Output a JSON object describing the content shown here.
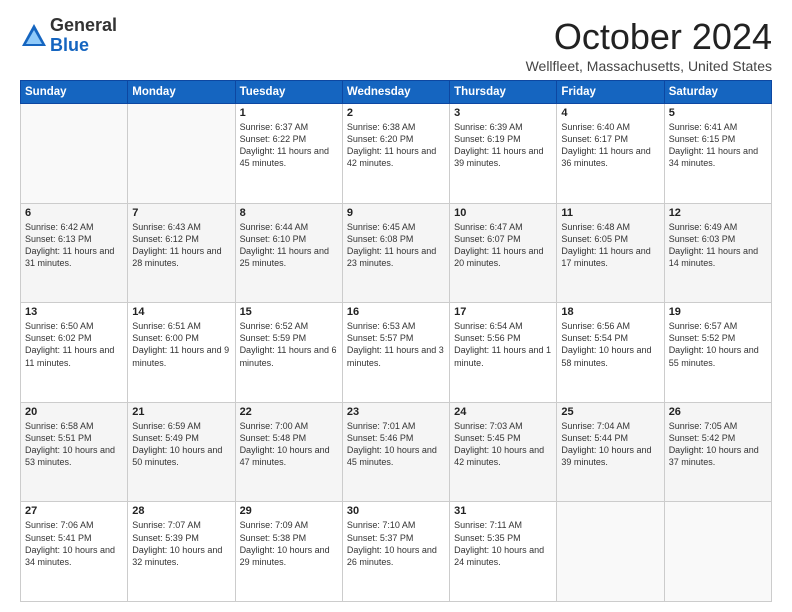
{
  "logo": {
    "general": "General",
    "blue": "Blue"
  },
  "title": "October 2024",
  "location": "Wellfleet, Massachusetts, United States",
  "days_header": [
    "Sunday",
    "Monday",
    "Tuesday",
    "Wednesday",
    "Thursday",
    "Friday",
    "Saturday"
  ],
  "weeks": [
    [
      {
        "day": "",
        "info": ""
      },
      {
        "day": "",
        "info": ""
      },
      {
        "day": "1",
        "info": "Sunrise: 6:37 AM\nSunset: 6:22 PM\nDaylight: 11 hours and 45 minutes."
      },
      {
        "day": "2",
        "info": "Sunrise: 6:38 AM\nSunset: 6:20 PM\nDaylight: 11 hours and 42 minutes."
      },
      {
        "day": "3",
        "info": "Sunrise: 6:39 AM\nSunset: 6:19 PM\nDaylight: 11 hours and 39 minutes."
      },
      {
        "day": "4",
        "info": "Sunrise: 6:40 AM\nSunset: 6:17 PM\nDaylight: 11 hours and 36 minutes."
      },
      {
        "day": "5",
        "info": "Sunrise: 6:41 AM\nSunset: 6:15 PM\nDaylight: 11 hours and 34 minutes."
      }
    ],
    [
      {
        "day": "6",
        "info": "Sunrise: 6:42 AM\nSunset: 6:13 PM\nDaylight: 11 hours and 31 minutes."
      },
      {
        "day": "7",
        "info": "Sunrise: 6:43 AM\nSunset: 6:12 PM\nDaylight: 11 hours and 28 minutes."
      },
      {
        "day": "8",
        "info": "Sunrise: 6:44 AM\nSunset: 6:10 PM\nDaylight: 11 hours and 25 minutes."
      },
      {
        "day": "9",
        "info": "Sunrise: 6:45 AM\nSunset: 6:08 PM\nDaylight: 11 hours and 23 minutes."
      },
      {
        "day": "10",
        "info": "Sunrise: 6:47 AM\nSunset: 6:07 PM\nDaylight: 11 hours and 20 minutes."
      },
      {
        "day": "11",
        "info": "Sunrise: 6:48 AM\nSunset: 6:05 PM\nDaylight: 11 hours and 17 minutes."
      },
      {
        "day": "12",
        "info": "Sunrise: 6:49 AM\nSunset: 6:03 PM\nDaylight: 11 hours and 14 minutes."
      }
    ],
    [
      {
        "day": "13",
        "info": "Sunrise: 6:50 AM\nSunset: 6:02 PM\nDaylight: 11 hours and 11 minutes."
      },
      {
        "day": "14",
        "info": "Sunrise: 6:51 AM\nSunset: 6:00 PM\nDaylight: 11 hours and 9 minutes."
      },
      {
        "day": "15",
        "info": "Sunrise: 6:52 AM\nSunset: 5:59 PM\nDaylight: 11 hours and 6 minutes."
      },
      {
        "day": "16",
        "info": "Sunrise: 6:53 AM\nSunset: 5:57 PM\nDaylight: 11 hours and 3 minutes."
      },
      {
        "day": "17",
        "info": "Sunrise: 6:54 AM\nSunset: 5:56 PM\nDaylight: 11 hours and 1 minute."
      },
      {
        "day": "18",
        "info": "Sunrise: 6:56 AM\nSunset: 5:54 PM\nDaylight: 10 hours and 58 minutes."
      },
      {
        "day": "19",
        "info": "Sunrise: 6:57 AM\nSunset: 5:52 PM\nDaylight: 10 hours and 55 minutes."
      }
    ],
    [
      {
        "day": "20",
        "info": "Sunrise: 6:58 AM\nSunset: 5:51 PM\nDaylight: 10 hours and 53 minutes."
      },
      {
        "day": "21",
        "info": "Sunrise: 6:59 AM\nSunset: 5:49 PM\nDaylight: 10 hours and 50 minutes."
      },
      {
        "day": "22",
        "info": "Sunrise: 7:00 AM\nSunset: 5:48 PM\nDaylight: 10 hours and 47 minutes."
      },
      {
        "day": "23",
        "info": "Sunrise: 7:01 AM\nSunset: 5:46 PM\nDaylight: 10 hours and 45 minutes."
      },
      {
        "day": "24",
        "info": "Sunrise: 7:03 AM\nSunset: 5:45 PM\nDaylight: 10 hours and 42 minutes."
      },
      {
        "day": "25",
        "info": "Sunrise: 7:04 AM\nSunset: 5:44 PM\nDaylight: 10 hours and 39 minutes."
      },
      {
        "day": "26",
        "info": "Sunrise: 7:05 AM\nSunset: 5:42 PM\nDaylight: 10 hours and 37 minutes."
      }
    ],
    [
      {
        "day": "27",
        "info": "Sunrise: 7:06 AM\nSunset: 5:41 PM\nDaylight: 10 hours and 34 minutes."
      },
      {
        "day": "28",
        "info": "Sunrise: 7:07 AM\nSunset: 5:39 PM\nDaylight: 10 hours and 32 minutes."
      },
      {
        "day": "29",
        "info": "Sunrise: 7:09 AM\nSunset: 5:38 PM\nDaylight: 10 hours and 29 minutes."
      },
      {
        "day": "30",
        "info": "Sunrise: 7:10 AM\nSunset: 5:37 PM\nDaylight: 10 hours and 26 minutes."
      },
      {
        "day": "31",
        "info": "Sunrise: 7:11 AM\nSunset: 5:35 PM\nDaylight: 10 hours and 24 minutes."
      },
      {
        "day": "",
        "info": ""
      },
      {
        "day": "",
        "info": ""
      }
    ]
  ]
}
